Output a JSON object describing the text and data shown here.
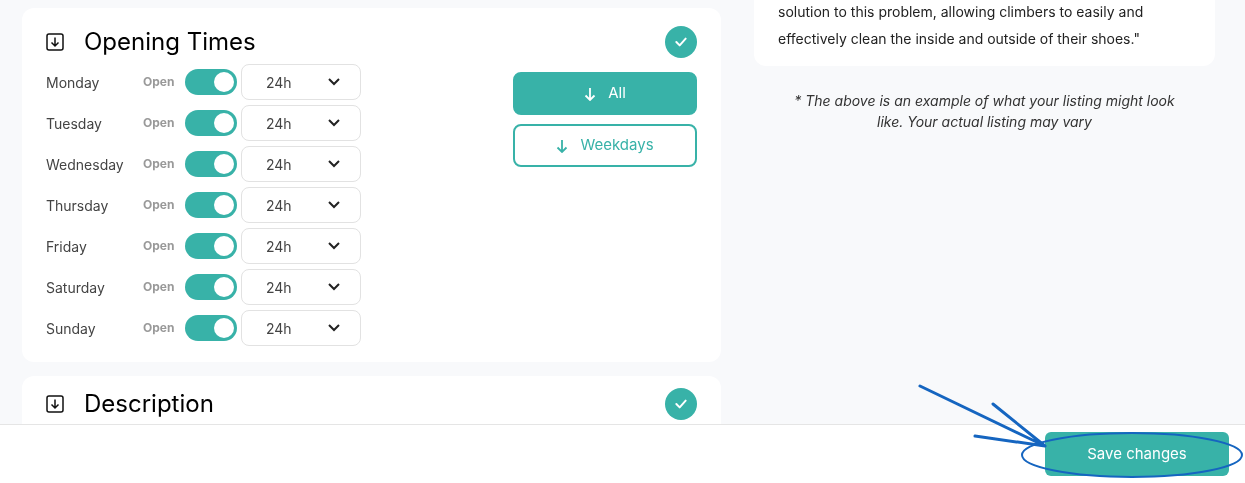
{
  "opening_times": {
    "title": "Opening Times",
    "complete": true,
    "days": [
      {
        "day": "Monday",
        "status_label": "Open",
        "open": true,
        "hours": "24h"
      },
      {
        "day": "Tuesday",
        "status_label": "Open",
        "open": true,
        "hours": "24h"
      },
      {
        "day": "Wednesday",
        "status_label": "Open",
        "open": true,
        "hours": "24h"
      },
      {
        "day": "Thursday",
        "status_label": "Open",
        "open": true,
        "hours": "24h"
      },
      {
        "day": "Friday",
        "status_label": "Open",
        "open": true,
        "hours": "24h"
      },
      {
        "day": "Saturday",
        "status_label": "Open",
        "open": true,
        "hours": "24h"
      },
      {
        "day": "Sunday",
        "status_label": "Open",
        "open": true,
        "hours": "24h"
      }
    ],
    "apply_buttons": [
      {
        "label": "All",
        "selected": true
      },
      {
        "label": "Weekdays",
        "selected": false
      }
    ]
  },
  "description": {
    "title": "Description",
    "complete": true
  },
  "preview": {
    "text_lines": [
      "solution to this problem, allowing climbers to easily and",
      "effectively clean the inside and outside of their shoes.\""
    ],
    "note": "* The above is an example of what your listing might look like. Your actual listing may vary"
  },
  "footer": {
    "save_button": "Save changes"
  }
}
